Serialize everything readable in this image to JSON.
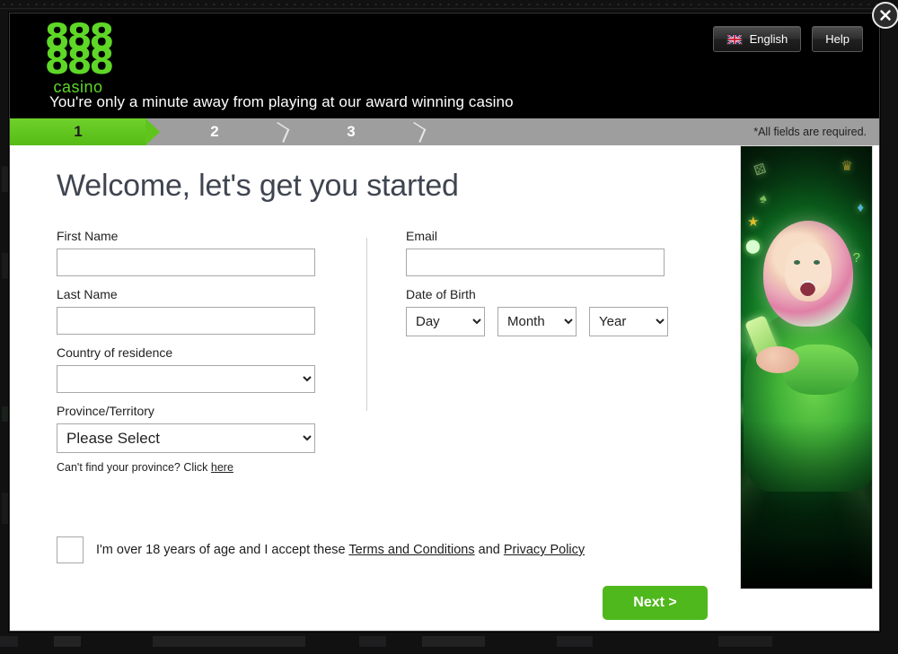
{
  "header": {
    "brand": {
      "eights_top": "888",
      "eights_bottom": "888",
      "word": "casino"
    },
    "language_button": "English",
    "language_flag_icon": "uk-flag-icon",
    "help_button": "Help",
    "close_icon": "close-icon",
    "tagline": "You're only a minute away from playing at our award winning casino"
  },
  "progress": {
    "steps": [
      {
        "number": "1",
        "active": true
      },
      {
        "number": "2",
        "active": false
      },
      {
        "number": "3",
        "active": false
      }
    ],
    "note": "*All fields are required."
  },
  "form": {
    "title": "Welcome, let's get you started",
    "first_name": {
      "label": "First Name",
      "value": "",
      "placeholder": ""
    },
    "last_name": {
      "label": "Last Name",
      "value": "",
      "placeholder": ""
    },
    "country": {
      "label": "Country of residence",
      "selected": "",
      "options": [
        ""
      ]
    },
    "province": {
      "label": "Province/Territory",
      "selected": "Please Select",
      "options": [
        "Please Select"
      ]
    },
    "province_hint": {
      "text_before": "Can't find your province? Click ",
      "link": "here"
    },
    "email": {
      "label": "Email",
      "value": "",
      "placeholder": ""
    },
    "dob": {
      "label": "Date of Birth",
      "day": {
        "selected": "Day",
        "options": [
          "Day"
        ]
      },
      "month": {
        "selected": "Month",
        "options": [
          "Month"
        ]
      },
      "year": {
        "selected": "Year",
        "options": [
          "Year"
        ]
      }
    },
    "terms": {
      "checked": false,
      "text_1": "I'm over 18 years of age and I accept these ",
      "link_terms": "Terms and Conditions",
      "text_2": " and ",
      "link_privacy": "Privacy Policy"
    },
    "next_button": "Next >"
  },
  "promo": {
    "alt": "woman-with-phone-promo-image",
    "icons": {
      "dice": "⚄",
      "crown": "♛",
      "star": "★",
      "chip": "⬤",
      "gem": "♦",
      "card": "♠",
      "question": "?",
      "sparkle": "✦"
    }
  },
  "colors": {
    "brand_green": "#5ed727",
    "button_green": "#4fb81c",
    "progress_gray": "#9e9e9e",
    "header_black": "#000000",
    "heading_gray": "#3f4550"
  }
}
